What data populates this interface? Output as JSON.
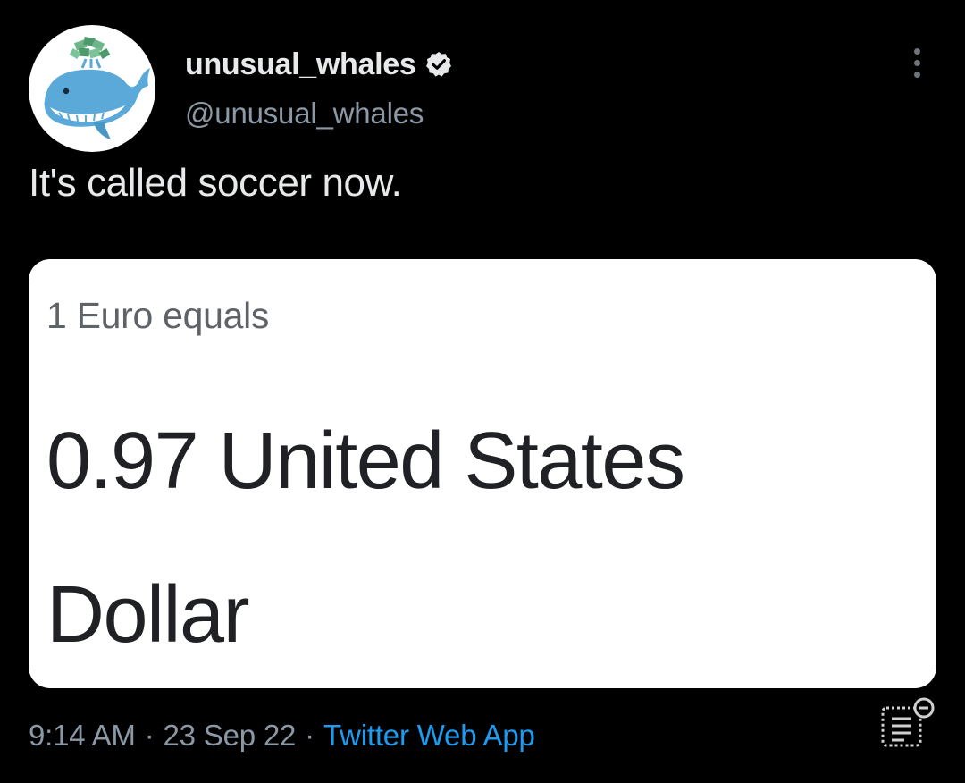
{
  "author": {
    "display_name": "unusual_whales",
    "handle": "@unusual_whales",
    "verified": true,
    "avatar_icon": "whale-avatar-icon"
  },
  "tweet": {
    "text": "It's called soccer now."
  },
  "card": {
    "label": "1 Euro equals",
    "result_line_1": "0.97 United States",
    "result_line_2": "Dollar"
  },
  "meta": {
    "time": "9:14 AM",
    "separator": "·",
    "date": "23 Sep 22",
    "source": "Twitter Web App"
  },
  "icons": {
    "more": "more-vertical-icon",
    "verified": "verified-badge-icon",
    "reader": "reader-list-icon"
  },
  "colors": {
    "background": "#000000",
    "text_primary": "#e7e9ea",
    "text_secondary": "#8b98a5",
    "link": "#1d9bf0",
    "card_background": "#ffffff"
  }
}
